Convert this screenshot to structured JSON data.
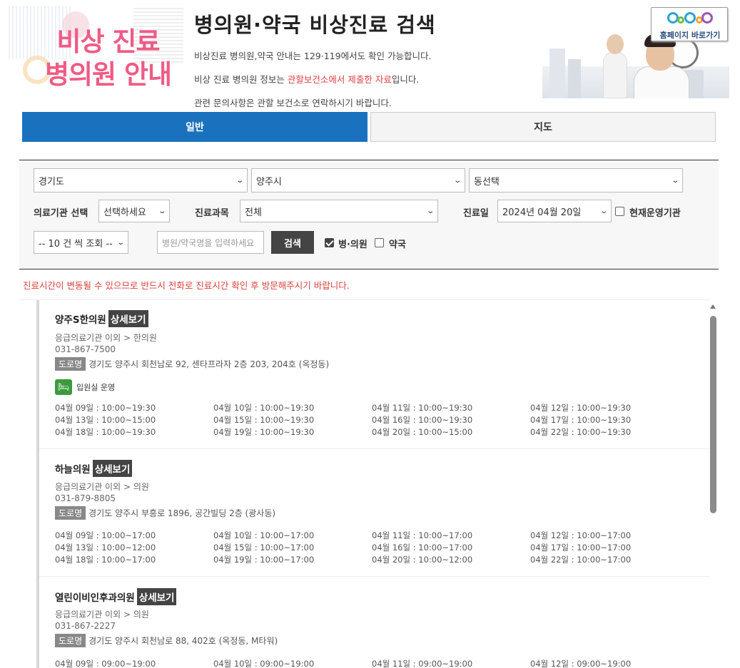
{
  "banner": {
    "left_title_line1": "비상 진료",
    "left_title_line2": "병의원 안내",
    "title": "병의원·약국 비상진료 검색",
    "line1": "비상진료 병의원,약국 안내는 129·119에서도 확인 가능합니다.",
    "line2_a": "비상 진료 병의원 정보는 ",
    "line2_red": "관할보건소에서 제출한 자료",
    "line2_b": "입니다.",
    "line3": "관련 문의사항은 관할 보건소로 연락하시기 바랍니다.",
    "home_button": "홈페이지 바로가기"
  },
  "tabs": [
    {
      "label": "일반",
      "active": true
    },
    {
      "label": "지도",
      "active": false
    }
  ],
  "search": {
    "province": "경기도",
    "city": "양주시",
    "dong": "동선택",
    "institution_label": "의료기관 선택",
    "institution_value": "선택하세요",
    "department_label": "진료과목",
    "department_value": "전체",
    "date_label": "진료일",
    "date_value": "2024년 04월 20일",
    "operating_label": "현재운영기관",
    "operating_checked": false,
    "page_size": "-- 10 건 씩 조회 --",
    "keyword_placeholder": "병원/약국명을 입력하세요",
    "search_button": "검색",
    "hospital_label": "병·의원",
    "hospital_checked": true,
    "pharmacy_label": "약국",
    "pharmacy_checked": false
  },
  "notice": "진료시간이 변동될 수 있으므로 반드시 전화로 진료시간 확인 후 방문해주시기 바랍니다.",
  "detail_label": "상세보기",
  "road_label": "도로명",
  "results": [
    {
      "name": "양주S한의원",
      "type": "응급의료기관 이외 > 한의원",
      "tel": "031-867-7500",
      "address": "경기도 양주시 회천남로 92, 센타프라자 2층 203, 204호 (옥정동)",
      "inpatient": "입원실 운영",
      "hours": [
        [
          "04월 09일 : 10:00~19:30",
          "04월 10일 : 10:00~19:30",
          "04월 11일 : 10:00~19:30",
          "04월 12일 : 10:00~19:30"
        ],
        [
          "04월 13일 : 10:00~15:00",
          "04월 15일 : 10:00~19:30",
          "04월 16일 : 10:00~19:30",
          "04월 17일 : 10:00~19:30"
        ],
        [
          "04월 18일 : 10:00~19:30",
          "04월 19일 : 10:00~19:30",
          "04월 20일 : 10:00~15:00",
          "04월 22일 : 10:00~19:30"
        ]
      ]
    },
    {
      "name": "하늘의원",
      "type": "응급의료기관 이외 > 의원",
      "tel": "031-879-8805",
      "address": "경기도 양주시 부흥로 1896, 공간빌딩 2층 (광사동)",
      "hours": [
        [
          "04월 09일 : 10:00~17:00",
          "04월 10일 : 10:00~17:00",
          "04월 11일 : 10:00~17:00",
          "04월 12일 : 10:00~17:00"
        ],
        [
          "04월 13일 : 10:00~12:00",
          "04월 15일 : 10:00~17:00",
          "04월 16일 : 10:00~17:00",
          "04월 17일 : 10:00~17:00"
        ],
        [
          "04월 18일 : 10:00~17:00",
          "04월 19일 : 10:00~17:00",
          "04월 20일 : 10:00~12:00",
          "04월 22일 : 10:00~17:00"
        ]
      ]
    },
    {
      "name": "열린이비인후과의원",
      "type": "응급의료기관 이외 > 의원",
      "tel": "031-867-2227",
      "address": "경기도 양주시 회천남로 88, 402호 (옥정동, M타워)",
      "hours": [
        [
          "04월 09일 : 09:00~19:00",
          "04월 10일 : 09:00~19:00",
          "04월 11일 : 09:00~19:00",
          "04월 12일 : 09:00~19:00"
        ]
      ]
    }
  ]
}
